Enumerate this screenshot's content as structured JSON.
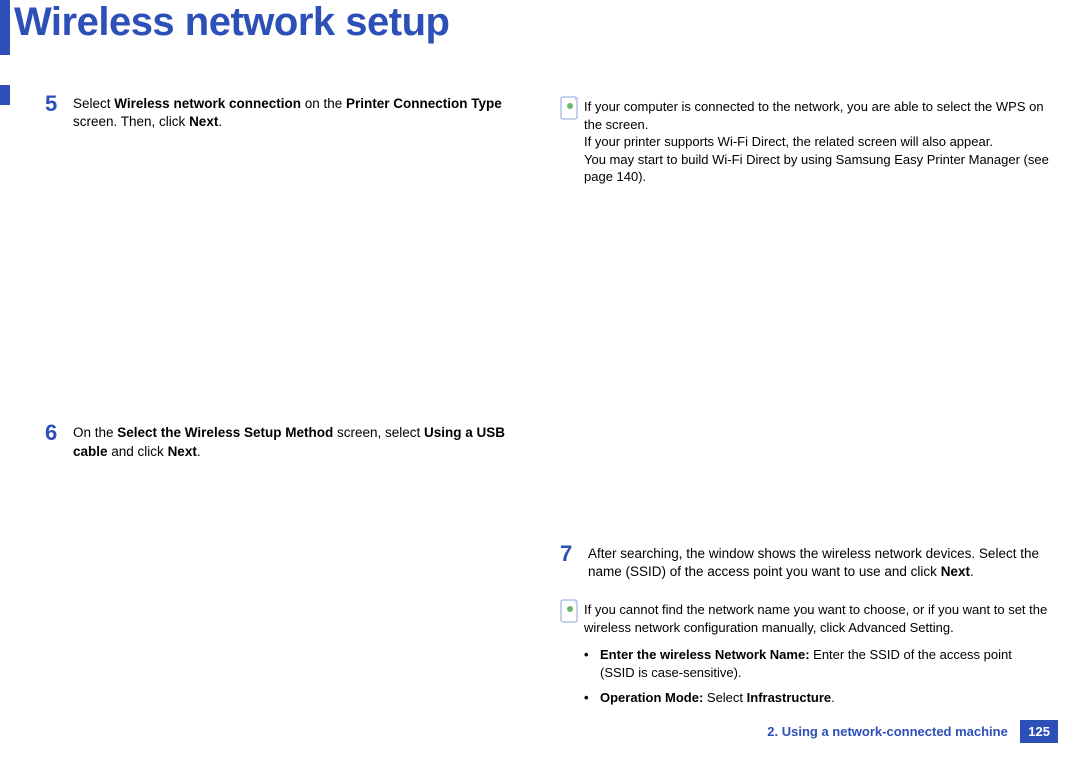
{
  "title": "Wireless network setup",
  "left": {
    "step5": {
      "num": "5",
      "t1": "Select ",
      "b1": "Wireless network connection",
      "t2": " on the ",
      "b2": "Printer Connection Type",
      "t3": " screen. Then, click ",
      "b3": "Next",
      "t4": "."
    },
    "step6": {
      "num": "6",
      "t1": "On the ",
      "b1": "Select the Wireless Setup Method",
      "t2": " screen, select ",
      "b2": "Using a USB cable",
      "t3": " and click ",
      "b3": "Next",
      "t4": "."
    }
  },
  "right": {
    "note1": {
      "line1": "If your computer is connected to the network, you are able to select the WPS on the screen.",
      "line2": "If your printer supports Wi-Fi Direct, the related screen will also appear.",
      "line3": "You may start to build Wi-Fi Direct by using Samsung Easy Printer Manager (see page 140)."
    },
    "step7": {
      "num": "7",
      "t1": "After searching, the window shows the wireless network devices. Select the name (SSID) of the access point you want to use and click ",
      "b1": "Next",
      "t2": "."
    },
    "note2": {
      "line1": "If you cannot find the network name you want to choose, or if you want to set the wireless network configuration manually, click ",
      "b1": "Advanced Setting",
      "t2": "."
    },
    "bullets": {
      "mark": "•",
      "b1": {
        "label": "Enter the wireless Network Name:",
        "rest": " Enter the SSID of the access point (SSID is case-sensitive)."
      },
      "b2": {
        "label": "Operation Mode:",
        "rest": " Select ",
        "b": "Infrastructure",
        "t": "."
      }
    }
  },
  "footer": {
    "chapter": "2.  Using a network-connected machine",
    "page": "125"
  }
}
